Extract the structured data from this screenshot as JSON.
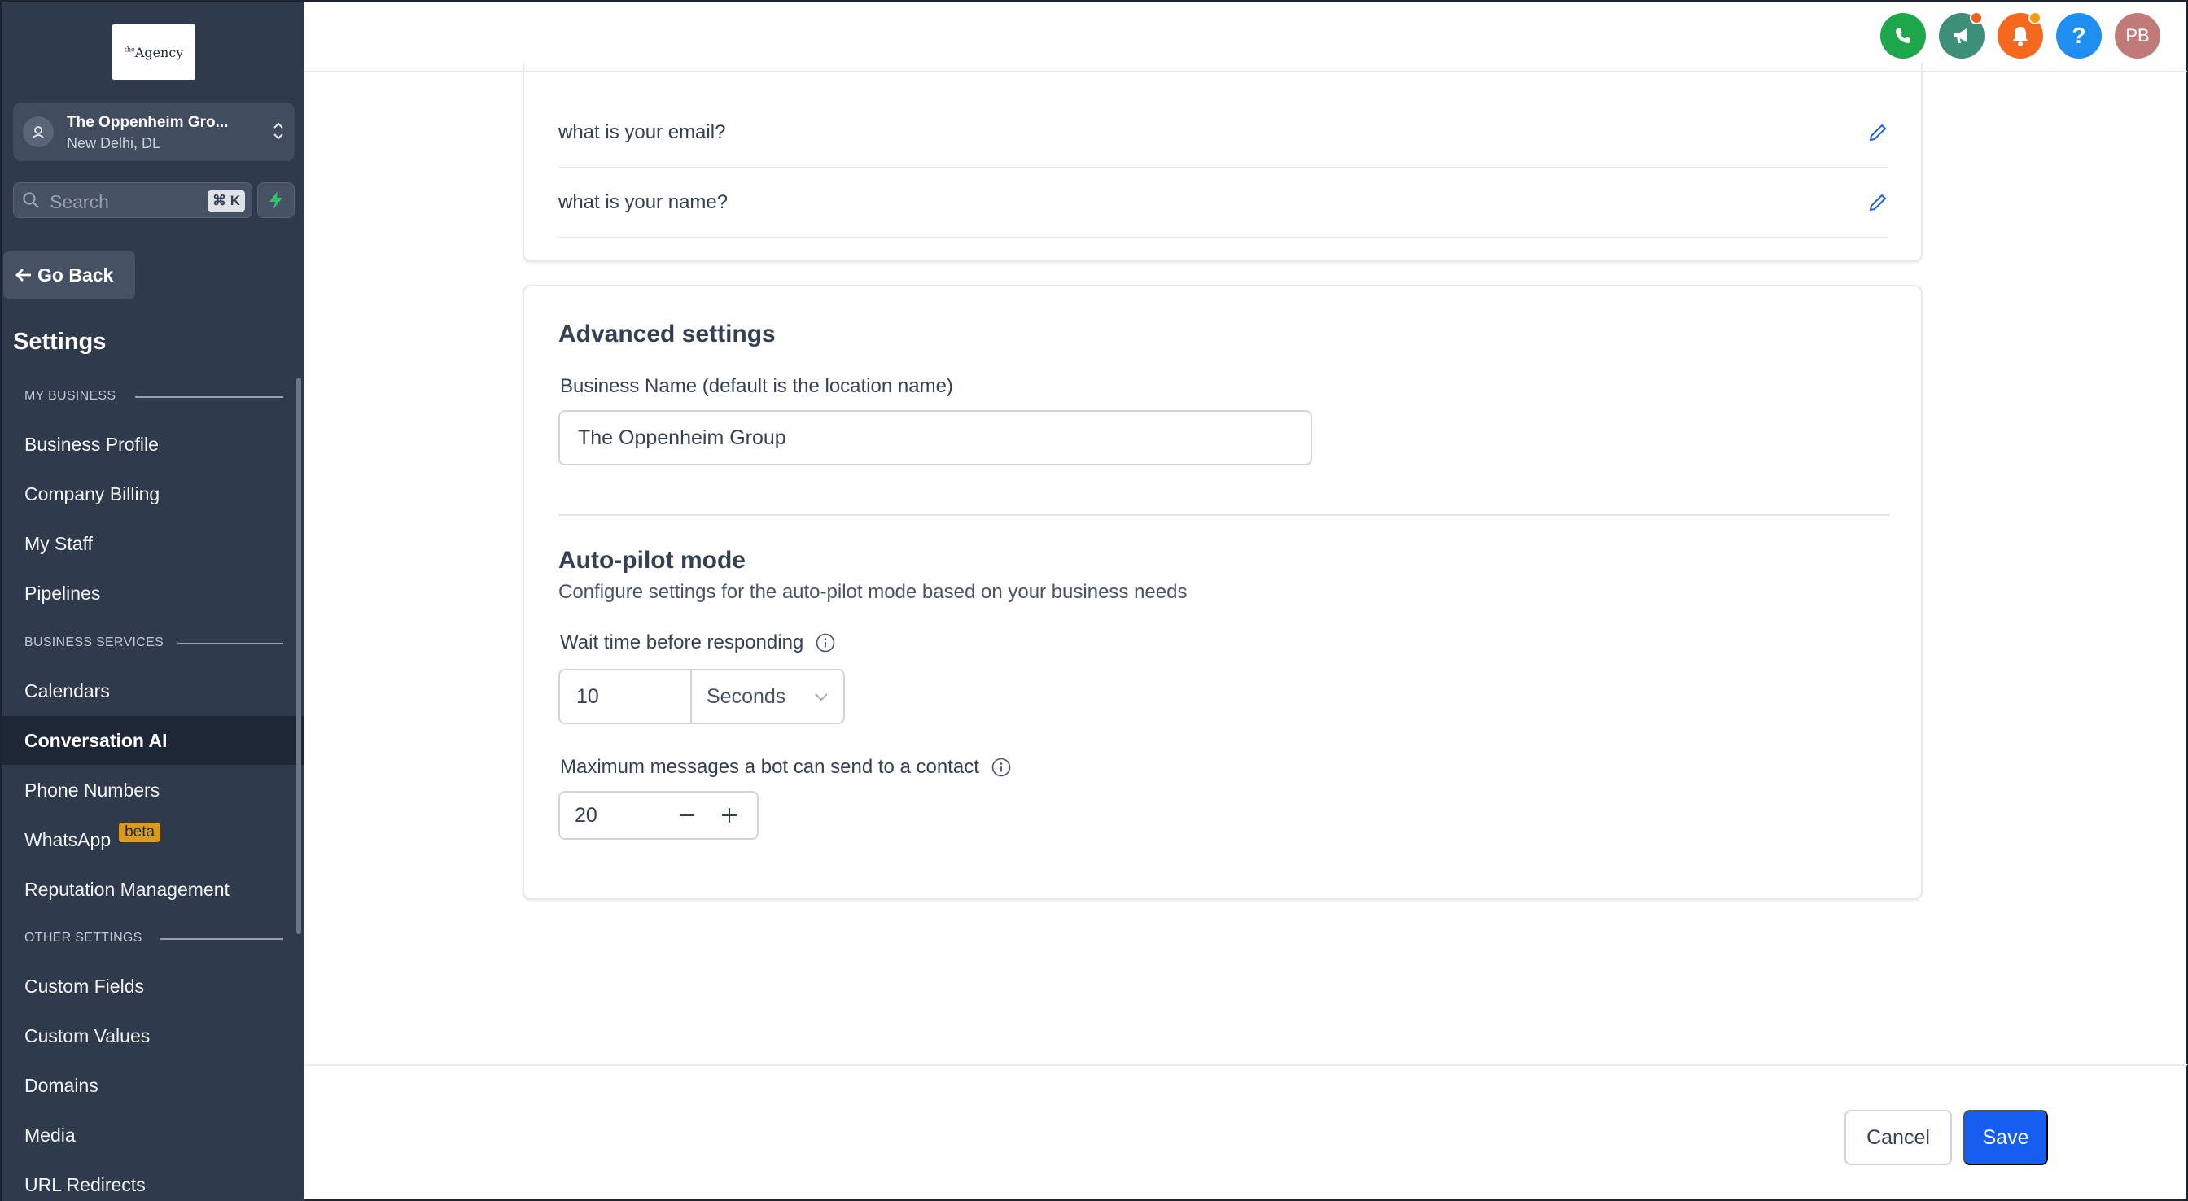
{
  "brand": {
    "logo_prefix": "the",
    "logo_text": "Agency"
  },
  "location": {
    "name": "The Oppenheim Gro...",
    "city": "New Delhi, DL"
  },
  "search": {
    "placeholder": "Search",
    "shortcut": "⌘ K"
  },
  "nav": {
    "go_back": "Go Back",
    "settings_title": "Settings",
    "sections": [
      {
        "label": "MY BUSINESS",
        "items": [
          "Business Profile",
          "Company Billing",
          "My Staff",
          "Pipelines"
        ]
      },
      {
        "label": "BUSINESS SERVICES",
        "items": [
          "Calendars",
          "Conversation AI",
          "Phone Numbers",
          "WhatsApp",
          "Reputation Management"
        ]
      },
      {
        "label": "OTHER SETTINGS",
        "items": [
          "Custom Fields",
          "Custom Values",
          "Domains",
          "Media",
          "URL Redirects"
        ]
      }
    ],
    "active_item": "Conversation AI",
    "beta_badge": "beta"
  },
  "topbar": {
    "avatar_initials": "PB",
    "colors": {
      "phone": "#1ea64a",
      "megaphone": "#3d8f77",
      "bell": "#f5691f",
      "help": "#1f8ef1",
      "avatar": "#c07b78"
    }
  },
  "questions": [
    "what is your email?",
    "what is your name?"
  ],
  "advanced": {
    "title": "Advanced settings",
    "business_name_label": "Business Name (default is the location name)",
    "business_name_value": "The Oppenheim Group",
    "autopilot_title": "Auto-pilot mode",
    "autopilot_desc": "Configure settings for the auto-pilot mode based on your business needs",
    "wait_label": "Wait time before responding",
    "wait_value": "10",
    "wait_unit": "Seconds",
    "max_label": "Maximum messages a bot can send to a contact",
    "max_value": "20"
  },
  "footer": {
    "cancel": "Cancel",
    "save": "Save",
    "accent": "#155eef"
  }
}
